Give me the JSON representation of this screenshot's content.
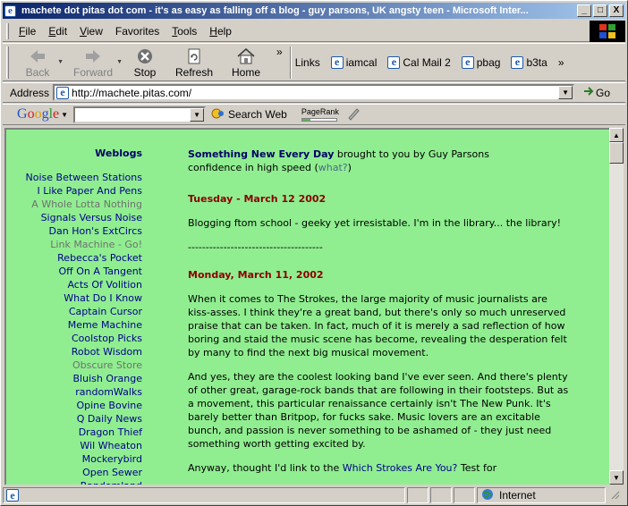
{
  "window": {
    "title": "machete dot pitas dot com - it's as easy as falling off a blog - guy parsons, UK angsty teen - Microsoft Inter...",
    "minimize": "_",
    "maximize": "□",
    "close": "X"
  },
  "menu": {
    "items": [
      {
        "key": "F",
        "rest": "ile"
      },
      {
        "key": "E",
        "rest": "dit"
      },
      {
        "key": "V",
        "rest": "iew"
      },
      {
        "key": "F",
        "rest": "avorites",
        "note": "Favorites"
      },
      {
        "key": "T",
        "rest": "ools"
      },
      {
        "key": "H",
        "rest": "elp"
      }
    ],
    "labels": [
      "File",
      "Edit",
      "View",
      "Favorites",
      "Tools",
      "Help"
    ]
  },
  "toolbar": {
    "back": "Back",
    "forward": "Forward",
    "stop": "Stop",
    "refresh": "Refresh",
    "home": "Home",
    "chevron": "»",
    "links_label": "Links",
    "links": [
      "iamcal",
      "Cal Mail 2",
      "pbag",
      "b3ta"
    ]
  },
  "address": {
    "label": "Address",
    "url": "http://machete.pitas.com/",
    "go": "Go"
  },
  "google": {
    "logo": "Google",
    "search_value": "",
    "search_web": "Search Web",
    "pagerank_label": "PageRank",
    "pagerank_fraction": 0.25
  },
  "sidebar": {
    "heading": "Weblogs",
    "items": [
      {
        "label": "Noise Between Stations",
        "dim": false
      },
      {
        "label": "I Like Paper And Pens",
        "dim": false
      },
      {
        "label": "A Whole Lotta Nothing",
        "dim": true
      },
      {
        "label": "Signals Versus Noise",
        "dim": false
      },
      {
        "label": "Dan Hon's ExtCircs",
        "dim": false
      },
      {
        "label": "Link Machine - Go!",
        "dim": true
      },
      {
        "label": "Rebecca's Pocket",
        "dim": false
      },
      {
        "label": "Off On A Tangent",
        "dim": false
      },
      {
        "label": "Acts Of Volition",
        "dim": false
      },
      {
        "label": "What Do I Know",
        "dim": false
      },
      {
        "label": "Captain Cursor",
        "dim": false
      },
      {
        "label": "Meme Machine",
        "dim": false
      },
      {
        "label": "Coolstop Picks",
        "dim": false
      },
      {
        "label": "Robot Wisdom",
        "dim": false
      },
      {
        "label": "Obscure Store",
        "dim": true
      },
      {
        "label": "Bluish Orange",
        "dim": false
      },
      {
        "label": "randomWalks",
        "dim": false
      },
      {
        "label": "Opine Bovine",
        "dim": false
      },
      {
        "label": "Q Daily News",
        "dim": false
      },
      {
        "label": "Dragon Thief",
        "dim": false
      },
      {
        "label": "Wil Wheaton",
        "dim": false
      },
      {
        "label": "Mockerybird",
        "dim": false
      },
      {
        "label": "Open Sewer",
        "dim": false
      },
      {
        "label": "Randomland",
        "dim": false
      }
    ]
  },
  "main": {
    "brand": "Something New Every Day",
    "intro": " brought to you by Guy Parsons",
    "tagline": "confidence in high speed (",
    "what": "what?",
    "tagline_end": ")",
    "date1": "Tuesday - March 12 2002",
    "post1": "Blogging ftom school - geeky yet irresistable. I'm in the library... the library!",
    "rule": "--------------------------------------",
    "date2": "Monday, March 11, 2002",
    "post2a": "When it comes to The Strokes, the large majority of music journalists are kiss-asses. I think they're a great band, but there's only so much unreserved praise that can be taken. In fact, much of it is merely a sad reflection of how boring and staid the music scene has become, revealing the desperation felt by many to find the next big musical movement.",
    "post2b": "And yes, they are the coolest looking band I've ever seen. And there's plenty of other great, garage-rock bands that are following in their footsteps. But as a movement, this particular renaissance certainly isn't The New Punk. It's barely better than Britpop, for fucks sake. Music lovers are an excitable bunch, and passion is never something to be ashamed of - they just need something worth getting excited by.",
    "post2c_start": "Anyway, thought I'd link to the ",
    "post2c_link": "Which Strokes Are You?",
    "post2c_end": " Test for"
  },
  "status": {
    "text": "",
    "zone": "Internet"
  },
  "colors": {
    "page_bg": "#90ee90",
    "link": "#00008b",
    "date": "#8b0000",
    "chrome": "#d4d0c8"
  }
}
